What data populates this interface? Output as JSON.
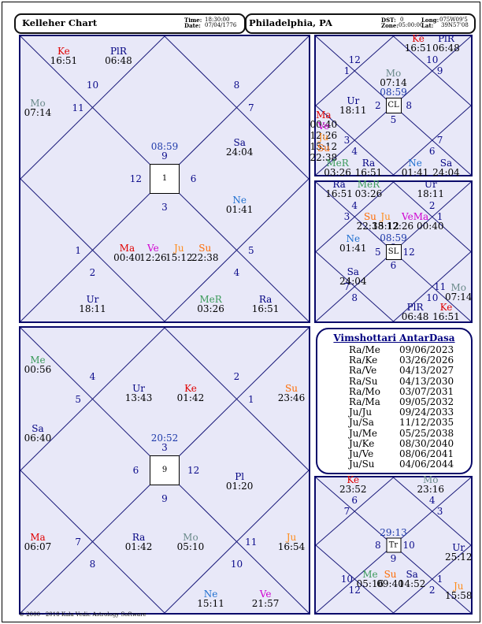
{
  "header": {
    "chart_name": "Kelleher Chart",
    "time_label": "Time:",
    "time_value": "18:30:00",
    "date_label": "Date:",
    "date_value": "07/04/1776",
    "place": "Philadelphia, PA",
    "dst_label": "DST:",
    "dst_value": "0",
    "zone_label": "Zone:",
    "zone_value": "05:00:00",
    "lon_label": "Long:",
    "lon_value": "075W09'5",
    "lat_label": "Lat:",
    "lat_value": "39N57'08"
  },
  "main_chart": {
    "center_box": "1",
    "center_label": "08:59",
    "center_house": "9",
    "houses": [
      "10",
      "11",
      "8",
      "7",
      "12",
      "6",
      "3",
      "1",
      "2",
      "5",
      "4"
    ],
    "planets": [
      {
        "name": "Ke",
        "deg": "16:51",
        "color": "#e00000"
      },
      {
        "name": "PlR",
        "deg": "06:48",
        "color": "#000080"
      },
      {
        "name": "Mo",
        "deg": "07:14",
        "color": "#6a8a8a"
      },
      {
        "name": "Sa",
        "deg": "24:04",
        "color": "#000080"
      },
      {
        "name": "Ne",
        "deg": "01:41",
        "color": "#1e6fd0"
      },
      {
        "name": "Ma",
        "deg": "00:40",
        "color": "#e00000"
      },
      {
        "name": "Ve",
        "deg": "12:26",
        "color": "#d000d0"
      },
      {
        "name": "Ju",
        "deg": "15:12",
        "color": "#ff8c1a"
      },
      {
        "name": "Su",
        "deg": "22:38",
        "color": "#ff6a00"
      },
      {
        "name": "Ur",
        "deg": "18:11",
        "color": "#000080"
      },
      {
        "name": "MeR",
        "deg": "03:26",
        "color": "#3a9a5a"
      },
      {
        "name": "Ra",
        "deg": "16:51",
        "color": "#000080"
      }
    ]
  },
  "navamsa_chart": {
    "center_box": "9",
    "center_label": "20:52",
    "center_house": "3",
    "houses": [
      "4",
      "5",
      "2",
      "1",
      "6",
      "12",
      "9",
      "7",
      "8",
      "11",
      "10"
    ],
    "planets": [
      {
        "name": "Me",
        "deg": "00:56",
        "color": "#3a9a5a"
      },
      {
        "name": "Ur",
        "deg": "13:43",
        "color": "#000080"
      },
      {
        "name": "Ke",
        "deg": "01:42",
        "color": "#e00000"
      },
      {
        "name": "Su",
        "deg": "23:46",
        "color": "#ff6a00"
      },
      {
        "name": "Sa",
        "deg": "06:40",
        "color": "#000080"
      },
      {
        "name": "Pl",
        "deg": "01:20",
        "color": "#000080"
      },
      {
        "name": "Ma",
        "deg": "06:07",
        "color": "#e00000"
      },
      {
        "name": "Ra",
        "deg": "01:42",
        "color": "#000080"
      },
      {
        "name": "Mo",
        "deg": "05:10",
        "color": "#6a8a8a"
      },
      {
        "name": "Ju",
        "deg": "16:54",
        "color": "#ff8c1a"
      },
      {
        "name": "Ne",
        "deg": "15:11",
        "color": "#1e6fd0"
      },
      {
        "name": "Ve",
        "deg": "21:57",
        "color": "#d000d0"
      }
    ]
  },
  "cl_chart": {
    "center_box": "CL",
    "center_label": "08:59",
    "center_house": "11",
    "houses": [
      "12",
      "1",
      "10",
      "9",
      "2",
      "8",
      "5",
      "3",
      "4",
      "7",
      "6"
    ],
    "planets": [
      {
        "name": "Ke",
        "deg": "16:51",
        "color": "#e00000"
      },
      {
        "name": "PlR",
        "deg": "06:48",
        "color": "#000080"
      },
      {
        "name": "Mo",
        "deg": "07:14",
        "color": "#6a8a8a"
      },
      {
        "name": "Ur",
        "deg": "18:11",
        "color": "#000080"
      },
      {
        "name": "Ma",
        "deg": "00:40",
        "color": "#e00000"
      },
      {
        "name": "Ve",
        "deg": "12:26",
        "color": "#d000d0"
      },
      {
        "name": "Ju",
        "deg": "15:12",
        "color": "#ff8c1a"
      },
      {
        "name": "Su",
        "deg": "22:38",
        "color": "#ff6a00"
      },
      {
        "name": "MeR",
        "deg": "03:26",
        "color": "#3a9a5a"
      },
      {
        "name": "Ra",
        "deg": "16:51",
        "color": "#000080"
      },
      {
        "name": "Ne",
        "deg": "01:41",
        "color": "#1e6fd0"
      },
      {
        "name": "Sa",
        "deg": "24:04",
        "color": "#000080"
      }
    ]
  },
  "sl_chart": {
    "center_box": "SL",
    "center_label": "08:59",
    "center_house": "9",
    "houses": [
      "4",
      "3",
      "2",
      "1",
      "5",
      "12",
      "6",
      "7",
      "8",
      "11",
      "10"
    ],
    "planets": [
      {
        "name": "Ra",
        "deg": "16:51",
        "color": "#000080"
      },
      {
        "name": "MeR",
        "deg": "03:26",
        "color": "#3a9a5a"
      },
      {
        "name": "Ur",
        "deg": "18:11",
        "color": "#000080"
      },
      {
        "name": "Su",
        "deg": "22:38",
        "color": "#ff6a00"
      },
      {
        "name": "Ju",
        "deg": "15:12",
        "color": "#ff8c1a"
      },
      {
        "name": "VeMa",
        "deg": "12:26 00:40",
        "color": "#d000d0"
      },
      {
        "name": "Ne",
        "deg": "01:41",
        "color": "#1e6fd0"
      },
      {
        "name": "Sa",
        "deg": "24:04",
        "color": "#000080"
      },
      {
        "name": "Mo",
        "deg": "07:14",
        "color": "#6a8a8a"
      },
      {
        "name": "PlR",
        "deg": "06:48",
        "color": "#000080"
      },
      {
        "name": "Ke",
        "deg": "16:51",
        "color": "#e00000"
      }
    ]
  },
  "tr_chart": {
    "center_box": "Tr",
    "center_label": "29:13",
    "center_house": "11",
    "houses": [
      "6",
      "7",
      "4",
      "3",
      "8",
      "10",
      "9",
      "10",
      "12",
      "1",
      "2"
    ],
    "planets": [
      {
        "name": "Ke",
        "deg": "23:52",
        "color": "#e00000"
      },
      {
        "name": "Mo",
        "deg": "23:16",
        "color": "#6a8a8a"
      },
      {
        "name": "Ur",
        "deg": "25:12",
        "color": "#000080"
      },
      {
        "name": "Ju",
        "deg": "15:58",
        "color": "#ff8c1a"
      },
      {
        "name": "Me",
        "deg": "05:16",
        "color": "#3a9a5a"
      },
      {
        "name": "Su",
        "deg": "09:40",
        "color": "#ff6a00"
      },
      {
        "name": "Sa",
        "deg": "14:52",
        "color": "#000080"
      }
    ]
  },
  "dasa": {
    "title": "Vimshottari AntarDasa",
    "rows": [
      {
        "period": "Ra/Me",
        "date": "09/06/2023"
      },
      {
        "period": "Ra/Ke",
        "date": "03/26/2026"
      },
      {
        "period": "Ra/Ve",
        "date": "04/13/2027"
      },
      {
        "period": "Ra/Su",
        "date": "04/13/2030"
      },
      {
        "period": "Ra/Mo",
        "date": "03/07/2031"
      },
      {
        "period": "Ra/Ma",
        "date": "09/05/2032"
      },
      {
        "period": "Ju/Ju",
        "date": "09/24/2033"
      },
      {
        "period": "Ju/Sa",
        "date": "11/12/2035"
      },
      {
        "period": "Ju/Me",
        "date": "05/25/2038"
      },
      {
        "period": "Ju/Ke",
        "date": "08/30/2040"
      },
      {
        "period": "Ju/Ve",
        "date": "08/06/2041"
      },
      {
        "period": "Ju/Su",
        "date": "04/06/2044"
      }
    ]
  },
  "footer": "© 2000 - 2018 Kala Vedic Astrology Software"
}
